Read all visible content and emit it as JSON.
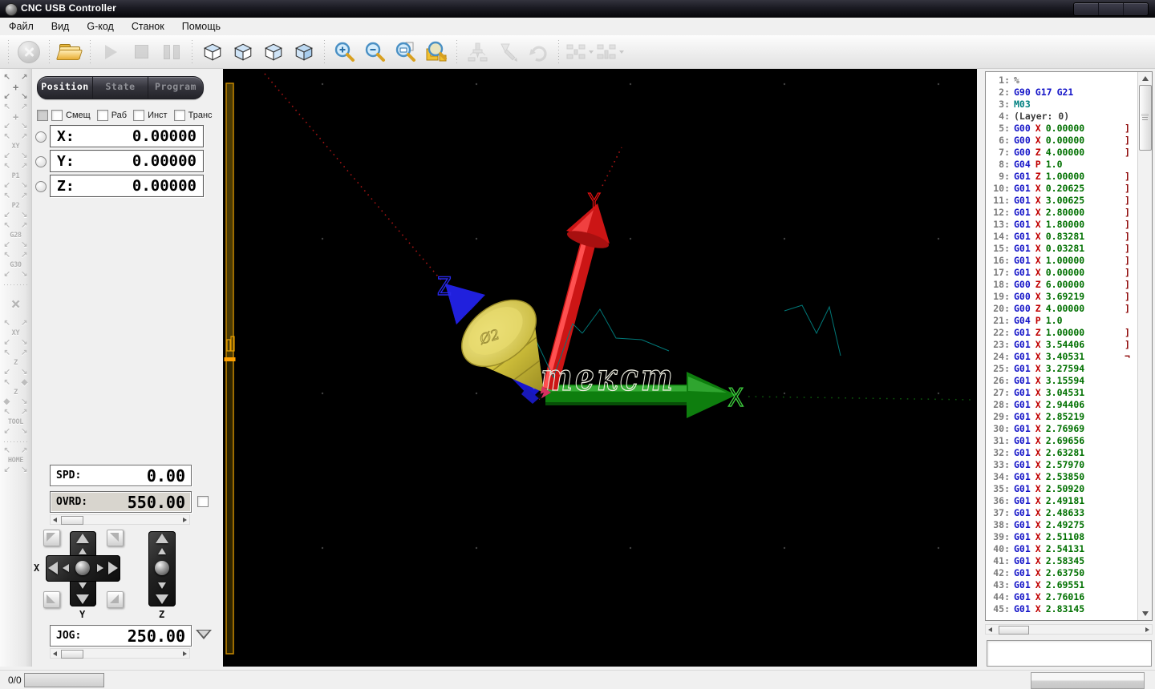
{
  "window": {
    "title": "CNC USB Controller",
    "icon": "app-gear-icon",
    "controls": [
      "minimize",
      "maximize",
      "close"
    ]
  },
  "menu": {
    "items": [
      "Файл",
      "Вид",
      "G-код",
      "Станок",
      "Помощь"
    ]
  },
  "toolbar": {
    "icons": [
      "reset-cancel-icon",
      "open-folder-icon",
      "play-icon",
      "stop-icon",
      "pause-icon",
      "view-cube-top-icon",
      "view-cube-left-icon",
      "view-cube-right-icon",
      "view-cube-iso-icon",
      "zoom-in-icon",
      "zoom-out-icon",
      "zoom-window-icon",
      "zoom-extents-icon",
      "machine-icon",
      "tool-icon",
      "rotate-icon",
      "axes-preset-1-icon",
      "axes-preset-2-icon"
    ]
  },
  "side_toolbar": {
    "items": [
      {
        "icon": "offset-move-icon",
        "label": "+",
        "variant": "dark"
      },
      {
        "icon": "offset-move-alt-icon",
        "label": "+",
        "variant": "light"
      },
      {
        "icon": "goto-xy-icon",
        "label": "XY"
      },
      {
        "icon": "goto-p1-icon",
        "label": "P1"
      },
      {
        "icon": "goto-p2-icon",
        "label": "P2"
      },
      {
        "icon": "goto-g28-icon",
        "label": "G28"
      },
      {
        "icon": "goto-g30-icon",
        "label": "G30"
      },
      {
        "sep": true
      },
      {
        "icon": "zero-all-icon",
        "label": "×",
        "variant": "cross"
      },
      {
        "icon": "zero-xy-icon",
        "label": "XY"
      },
      {
        "icon": "zero-z-icon",
        "label": "Z"
      },
      {
        "icon": "measure-z-icon",
        "label": "Z",
        "variant": "diamond"
      },
      {
        "icon": "tool-change-icon",
        "label": "TOOL"
      },
      {
        "sep": true
      },
      {
        "icon": "home-icon",
        "label": "HOME"
      }
    ]
  },
  "panel": {
    "tabs": [
      {
        "label": "Position",
        "active": true
      },
      {
        "label": "State",
        "active": false
      },
      {
        "label": "Program",
        "active": false
      }
    ],
    "checkboxes": [
      {
        "label": "",
        "shaded": true
      },
      {
        "label": "Смещ"
      },
      {
        "label": "Раб"
      },
      {
        "label": "Инст"
      },
      {
        "label": "Транс"
      }
    ],
    "axes": [
      {
        "label": "X:",
        "value": "0.00000"
      },
      {
        "label": "Y:",
        "value": "0.00000"
      },
      {
        "label": "Z:",
        "value": "0.00000"
      }
    ],
    "spd": {
      "label": "SPD:",
      "value": "0.00"
    },
    "ovrd": {
      "label": "OVRD:",
      "value": "550.00"
    },
    "jog": {
      "label": "JOG:",
      "value": "250.00"
    },
    "jog_axis_labels": {
      "x": "X",
      "y": "Y",
      "z": "Z"
    }
  },
  "viewport": {
    "axis_labels": {
      "x": "X",
      "y": "Y",
      "z": "Z"
    },
    "engraving_text": "текст",
    "tool_mark": "Ø2",
    "colors": {
      "x_axis": "#0E7E0E",
      "y_axis": "#CC1515",
      "z_axis": "#1616CC",
      "tool": "#D8C840",
      "rapid_dotted": "#A81414",
      "path_teal": "#007878",
      "depth_bar": "#E8A000"
    }
  },
  "gcode": {
    "lines": [
      {
        "n": 1,
        "t": [
          [
            "p",
            "%"
          ]
        ]
      },
      {
        "n": 2,
        "t": [
          [
            "g",
            "G90"
          ],
          [
            "g",
            "G17"
          ],
          [
            "g",
            "G21"
          ]
        ]
      },
      {
        "n": 3,
        "t": [
          [
            "m",
            "M03"
          ]
        ]
      },
      {
        "n": 4,
        "t": [
          [
            "c",
            "(Layer: 0)"
          ]
        ]
      },
      {
        "n": 5,
        "t": [
          [
            "g",
            "G00"
          ],
          [
            "a",
            "X"
          ],
          [
            "v",
            "0.00000"
          ]
        ],
        "br": "]"
      },
      {
        "n": 6,
        "t": [
          [
            "g",
            "G00"
          ],
          [
            "a",
            "X"
          ],
          [
            "v",
            "0.00000"
          ]
        ],
        "br": "]"
      },
      {
        "n": 7,
        "t": [
          [
            "g",
            "G00"
          ],
          [
            "a",
            "Z"
          ],
          [
            "v",
            "4.00000"
          ]
        ],
        "br": "]"
      },
      {
        "n": 8,
        "t": [
          [
            "g",
            "G04"
          ],
          [
            "a",
            "P"
          ],
          [
            "v",
            "1.0"
          ]
        ]
      },
      {
        "n": 9,
        "t": [
          [
            "g",
            "G01"
          ],
          [
            "a",
            "Z"
          ],
          [
            "v",
            "1.00000"
          ]
        ],
        "br": "]"
      },
      {
        "n": 10,
        "t": [
          [
            "g",
            "G01"
          ],
          [
            "a",
            "X"
          ],
          [
            "v",
            "0.20625"
          ]
        ],
        "br": "]"
      },
      {
        "n": 11,
        "t": [
          [
            "g",
            "G01"
          ],
          [
            "a",
            "X"
          ],
          [
            "v",
            "3.00625"
          ]
        ],
        "br": "]"
      },
      {
        "n": 12,
        "t": [
          [
            "g",
            "G01"
          ],
          [
            "a",
            "X"
          ],
          [
            "v",
            "2.80000"
          ]
        ],
        "br": "]"
      },
      {
        "n": 13,
        "t": [
          [
            "g",
            "G01"
          ],
          [
            "a",
            "X"
          ],
          [
            "v",
            "1.80000"
          ]
        ],
        "br": "]"
      },
      {
        "n": 14,
        "t": [
          [
            "g",
            "G01"
          ],
          [
            "a",
            "X"
          ],
          [
            "v",
            "0.83281"
          ]
        ],
        "br": "]"
      },
      {
        "n": 15,
        "t": [
          [
            "g",
            "G01"
          ],
          [
            "a",
            "X"
          ],
          [
            "v",
            "0.03281"
          ]
        ],
        "br": "]"
      },
      {
        "n": 16,
        "t": [
          [
            "g",
            "G01"
          ],
          [
            "a",
            "X"
          ],
          [
            "v",
            "1.00000"
          ]
        ],
        "br": "]"
      },
      {
        "n": 17,
        "t": [
          [
            "g",
            "G01"
          ],
          [
            "a",
            "X"
          ],
          [
            "v",
            "0.00000"
          ]
        ],
        "br": "]"
      },
      {
        "n": 18,
        "t": [
          [
            "g",
            "G00"
          ],
          [
            "a",
            "Z"
          ],
          [
            "v",
            "6.00000"
          ]
        ],
        "br": "]"
      },
      {
        "n": 19,
        "t": [
          [
            "g",
            "G00"
          ],
          [
            "a",
            "X"
          ],
          [
            "v",
            "3.69219"
          ]
        ],
        "br": "]"
      },
      {
        "n": 20,
        "t": [
          [
            "g",
            "G00"
          ],
          [
            "a",
            "Z"
          ],
          [
            "v",
            "4.00000"
          ]
        ],
        "br": "]"
      },
      {
        "n": 21,
        "t": [
          [
            "g",
            "G04"
          ],
          [
            "a",
            "P"
          ],
          [
            "v",
            "1.0"
          ]
        ]
      },
      {
        "n": 22,
        "t": [
          [
            "g",
            "G01"
          ],
          [
            "a",
            "Z"
          ],
          [
            "v",
            "1.00000"
          ]
        ],
        "br": "]"
      },
      {
        "n": 23,
        "t": [
          [
            "g",
            "G01"
          ],
          [
            "a",
            "X"
          ],
          [
            "v",
            "3.54406"
          ]
        ],
        "br": "]"
      },
      {
        "n": 24,
        "t": [
          [
            "g",
            "G01"
          ],
          [
            "a",
            "X"
          ],
          [
            "v",
            "3.40531"
          ]
        ],
        "br": "¬"
      },
      {
        "n": 25,
        "t": [
          [
            "g",
            "G01"
          ],
          [
            "a",
            "X"
          ],
          [
            "v",
            "3.27594"
          ]
        ]
      },
      {
        "n": 26,
        "t": [
          [
            "g",
            "G01"
          ],
          [
            "a",
            "X"
          ],
          [
            "v",
            "3.15594"
          ]
        ]
      },
      {
        "n": 27,
        "t": [
          [
            "g",
            "G01"
          ],
          [
            "a",
            "X"
          ],
          [
            "v",
            "3.04531"
          ]
        ]
      },
      {
        "n": 28,
        "t": [
          [
            "g",
            "G01"
          ],
          [
            "a",
            "X"
          ],
          [
            "v",
            "2.94406"
          ]
        ]
      },
      {
        "n": 29,
        "t": [
          [
            "g",
            "G01"
          ],
          [
            "a",
            "X"
          ],
          [
            "v",
            "2.85219"
          ]
        ]
      },
      {
        "n": 30,
        "t": [
          [
            "g",
            "G01"
          ],
          [
            "a",
            "X"
          ],
          [
            "v",
            "2.76969"
          ]
        ]
      },
      {
        "n": 31,
        "t": [
          [
            "g",
            "G01"
          ],
          [
            "a",
            "X"
          ],
          [
            "v",
            "2.69656"
          ]
        ]
      },
      {
        "n": 32,
        "t": [
          [
            "g",
            "G01"
          ],
          [
            "a",
            "X"
          ],
          [
            "v",
            "2.63281"
          ]
        ]
      },
      {
        "n": 33,
        "t": [
          [
            "g",
            "G01"
          ],
          [
            "a",
            "X"
          ],
          [
            "v",
            "2.57970"
          ]
        ]
      },
      {
        "n": 34,
        "t": [
          [
            "g",
            "G01"
          ],
          [
            "a",
            "X"
          ],
          [
            "v",
            "2.53850"
          ]
        ]
      },
      {
        "n": 35,
        "t": [
          [
            "g",
            "G01"
          ],
          [
            "a",
            "X"
          ],
          [
            "v",
            "2.50920"
          ]
        ]
      },
      {
        "n": 36,
        "t": [
          [
            "g",
            "G01"
          ],
          [
            "a",
            "X"
          ],
          [
            "v",
            "2.49181"
          ]
        ]
      },
      {
        "n": 37,
        "t": [
          [
            "g",
            "G01"
          ],
          [
            "a",
            "X"
          ],
          [
            "v",
            "2.48633"
          ]
        ]
      },
      {
        "n": 38,
        "t": [
          [
            "g",
            "G01"
          ],
          [
            "a",
            "X"
          ],
          [
            "v",
            "2.49275"
          ]
        ]
      },
      {
        "n": 39,
        "t": [
          [
            "g",
            "G01"
          ],
          [
            "a",
            "X"
          ],
          [
            "v",
            "2.51108"
          ]
        ]
      },
      {
        "n": 40,
        "t": [
          [
            "g",
            "G01"
          ],
          [
            "a",
            "X"
          ],
          [
            "v",
            "2.54131"
          ]
        ]
      },
      {
        "n": 41,
        "t": [
          [
            "g",
            "G01"
          ],
          [
            "a",
            "X"
          ],
          [
            "v",
            "2.58345"
          ]
        ]
      },
      {
        "n": 42,
        "t": [
          [
            "g",
            "G01"
          ],
          [
            "a",
            "X"
          ],
          [
            "v",
            "2.63750"
          ]
        ]
      },
      {
        "n": 43,
        "t": [
          [
            "g",
            "G01"
          ],
          [
            "a",
            "X"
          ],
          [
            "v",
            "2.69551"
          ]
        ]
      },
      {
        "n": 44,
        "t": [
          [
            "g",
            "G01"
          ],
          [
            "a",
            "X"
          ],
          [
            "v",
            "2.76016"
          ]
        ]
      },
      {
        "n": 45,
        "t": [
          [
            "g",
            "G01"
          ],
          [
            "a",
            "X"
          ],
          [
            "v",
            "2.83145"
          ]
        ]
      }
    ]
  },
  "statusbar": {
    "counter": "0/0"
  }
}
